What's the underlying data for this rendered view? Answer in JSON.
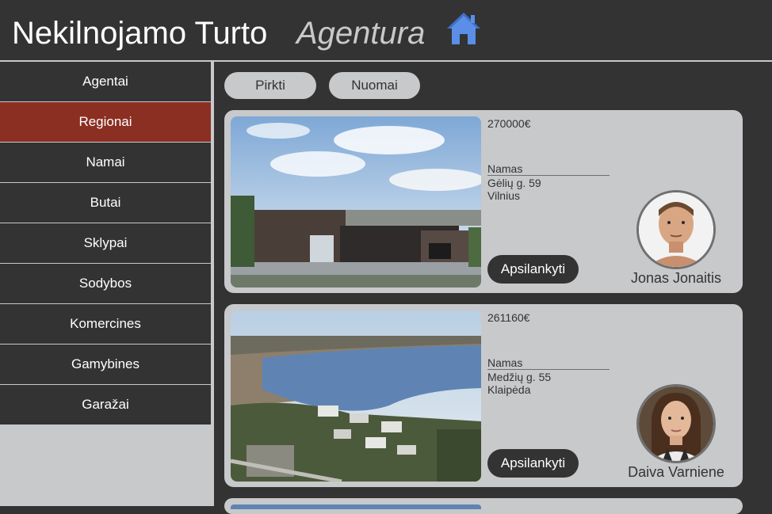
{
  "header": {
    "title_main": "Nekilnojamo Turto",
    "title_accent": "Agentura",
    "icon": "home-icon"
  },
  "sidebar": {
    "items": [
      {
        "label": "Agentai",
        "active": false
      },
      {
        "label": "Regionai",
        "active": true
      },
      {
        "label": "Namai",
        "active": false
      },
      {
        "label": "Butai",
        "active": false
      },
      {
        "label": "Sklypai",
        "active": false
      },
      {
        "label": "Sodybos",
        "active": false
      },
      {
        "label": "Komercines",
        "active": false
      },
      {
        "label": "Gamybines",
        "active": false
      },
      {
        "label": "Garažai",
        "active": false
      }
    ]
  },
  "filters": {
    "buy_label": "Pirkti",
    "rent_label": "Nuomai"
  },
  "listings": [
    {
      "price": "270000€",
      "type": "Namas",
      "street": "Gėlių g. 59",
      "city": "Vilnius",
      "button_label": "Apsilankyti",
      "agent_name": "Jonas Jonaitis"
    },
    {
      "price": "261160€",
      "type": "Namas",
      "street": "Medžių g. 55",
      "city": "Klaipėda",
      "button_label": "Apsilankyti",
      "agent_name": "Daiva Varniene"
    }
  ],
  "colors": {
    "background": "#333333",
    "panel": "#c7c9cb",
    "active_nav": "#8b2f23",
    "home_icon": "#5b8ee6"
  }
}
